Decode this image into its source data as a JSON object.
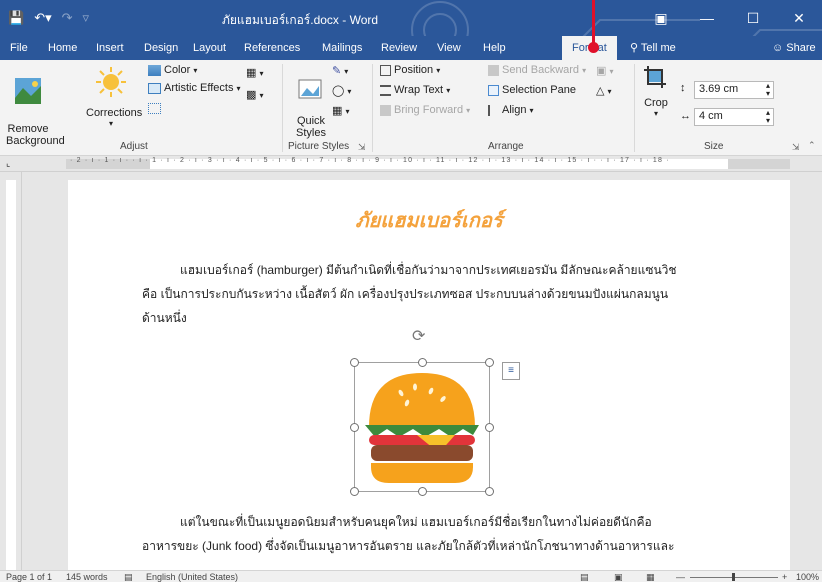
{
  "window": {
    "title": "ภัยแฮมเบอร์เกอร์.docx - Word",
    "qat_icons": [
      "save-icon",
      "undo-icon",
      "redo-icon",
      "customize-icon"
    ],
    "controls": [
      "ribbon-display-icon",
      "minimize-icon",
      "maximize-icon",
      "close-icon"
    ]
  },
  "tabs": [
    {
      "label": "File"
    },
    {
      "label": "Home"
    },
    {
      "label": "Insert"
    },
    {
      "label": "Design"
    },
    {
      "label": "Layout"
    },
    {
      "label": "References"
    },
    {
      "label": "Mailings"
    },
    {
      "label": "Review"
    },
    {
      "label": "View"
    },
    {
      "label": "Help"
    },
    {
      "label": "Format",
      "active": true
    },
    {
      "label": "Tell me"
    },
    {
      "label": "Share"
    }
  ],
  "ribbon": {
    "adjust": {
      "remove_background": "Remove\nBackground",
      "corrections": "Corrections",
      "color": "Color",
      "artistic_effects": "Artistic Effects",
      "label": "Adjust"
    },
    "picture_styles": {
      "quick_styles": "Quick\nStyles",
      "label": "Picture Styles"
    },
    "arrange": {
      "position": "Position",
      "wrap_text": "Wrap Text",
      "bring_forward": "Bring Forward",
      "send_backward": "Send Backward",
      "selection_pane": "Selection Pane",
      "align": "Align",
      "label": "Arrange"
    },
    "size": {
      "crop": "Crop",
      "height": "3.69 cm",
      "width": "4 cm",
      "label": "Size"
    }
  },
  "ruler": {
    "ticks": "· 2 · ı · 1 · ı ·    · ı · 1 · ı · 2 · ı · 3 · ı · 4 · ı · 5 · ı · 6 · ı · 7 · ı · 8 · ı · 9 · ı · 10 · ı · 11 · ı · 12 · ı · 13 · ı · 14 · ı · 15 · ı ·    · ı · 17 · ı · 18 ·"
  },
  "document": {
    "heading": "ภัยแฮมเบอร์เกอร์",
    "para1_line1": "แฮมเบอร์เกอร์ (hamburger) มีต้นกำเนิดที่เชื่อกันว่ามาจากประเทศเยอรมัน มีลักษณะคล้ายแซนวิช",
    "para1_line2": "คือ เป็นการประกบกันระหว่าง เนื้อสัตว์ ผัก เครื่องปรุงประเภทซอส ประกบบนล่างด้วยขนมปังแผ่นกลมนูน",
    "para1_line3": "ด้านหนึ่ง",
    "para2_line1": "แต่ในขณะที่เป็นเมนูยอดนิยมสำหรับคนยุคใหม่  แฮมเบอร์เกอร์มีชื่อเรียกในทางไม่ค่อยดีนักคือ",
    "para2_line2": "อาหารขยะ (Junk food) ซึ่งจัดเป็นเมนูอาหารอันตราย และภัยใกล้ตัวที่เหล่านักโภชนาทางด้านอาหารและ"
  },
  "status": {
    "page": "Page 1 of 1",
    "words": "145 words",
    "language": "English (United States)",
    "zoom": "100%"
  },
  "colors": {
    "word_blue": "#2b579a",
    "heading_orange": "#f4a23c",
    "pointer_red": "#e0102a"
  }
}
